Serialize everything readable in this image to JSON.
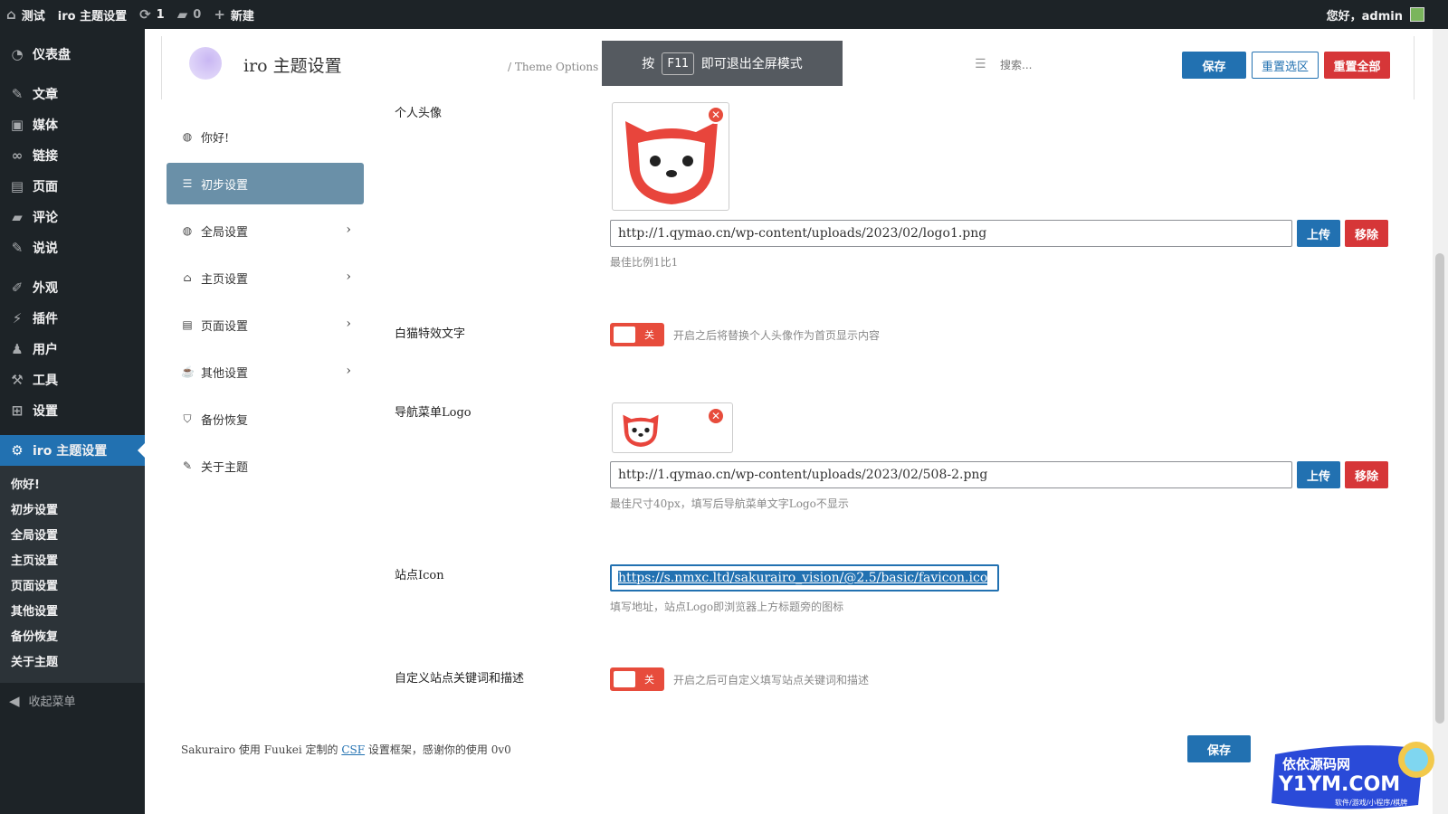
{
  "adminbar": {
    "site_name": "测试",
    "page_name": "iro 主题设置",
    "updates": "1",
    "comments": "0",
    "new_label": "新建",
    "greeting": "您好，admin"
  },
  "wp_menu": {
    "items": [
      {
        "label": "仪表盘"
      },
      {
        "label": "文章"
      },
      {
        "label": "媒体"
      },
      {
        "label": "链接"
      },
      {
        "label": "页面"
      },
      {
        "label": "评论"
      },
      {
        "label": "说说"
      },
      {
        "label": "外观"
      },
      {
        "label": "插件"
      },
      {
        "label": "用户"
      },
      {
        "label": "工具"
      },
      {
        "label": "设置"
      }
    ],
    "active": "iro 主题设置",
    "submenu": [
      "你好!",
      "初步设置",
      "全局设置",
      "主页设置",
      "页面设置",
      "其他设置",
      "备份恢复",
      "关于主题"
    ],
    "collapse": "收起菜单"
  },
  "header": {
    "title": "iro 主题设置",
    "subtitle": "/ Theme Options / テーマの設定",
    "fs_notice_pre": "按",
    "fs_key": "F11",
    "fs_notice_post": "即可退出全屏模式",
    "search_placeholder": "搜索...",
    "save": "保存",
    "reset_section": "重置选区",
    "reset_all": "重置全部"
  },
  "options_nav": {
    "items": [
      {
        "label": "你好!"
      },
      {
        "label": "初步设置"
      },
      {
        "label": "全局设置"
      },
      {
        "label": "主页设置"
      },
      {
        "label": "页面设置"
      },
      {
        "label": "其他设置"
      },
      {
        "label": "备份恢复"
      },
      {
        "label": "关于主题"
      }
    ]
  },
  "fields": {
    "avatar": {
      "label": "个人头像",
      "url": "http://1.qymao.cn/wp-content/uploads/2023/02/logo1.png",
      "upload": "上传",
      "remove": "移除",
      "help": "最佳比例1比1"
    },
    "white_cat": {
      "label": "白猫特效文字",
      "toggle": "关",
      "desc": "开启之后将替换个人头像作为首页显示内容"
    },
    "nav_logo": {
      "label": "导航菜单Logo",
      "url": "http://1.qymao.cn/wp-content/uploads/2023/02/508-2.png",
      "upload": "上传",
      "remove": "移除",
      "help": "最佳尺寸40px，填写后导航菜单文字Logo不显示"
    },
    "site_icon": {
      "label": "站点Icon",
      "value": "https://s.nmxc.ltd/sakurairo_vision/@2.5/basic/favicon.ico",
      "help": "填写地址，站点Logo即浏览器上方标题旁的图标"
    },
    "seo": {
      "label": "自定义站点关键词和描述",
      "toggle": "关",
      "desc": "开启之后可自定义填写站点关键词和描述"
    }
  },
  "footer": {
    "text_pre": "Sakurairo 使用 Fuukei 定制的",
    "link": "CSF",
    "text_post": "设置框架，感谢你的使用 0v0",
    "save": "保存"
  },
  "watermark": {
    "line1": "依依源码网",
    "line2": "Y1YM.COM",
    "line3": "软件/游戏/小程序/棋牌"
  },
  "colors": {
    "adminbar": "#1d2327",
    "accent": "#2271b1",
    "danger": "#d63638",
    "active_nav": "#6a90a8"
  }
}
